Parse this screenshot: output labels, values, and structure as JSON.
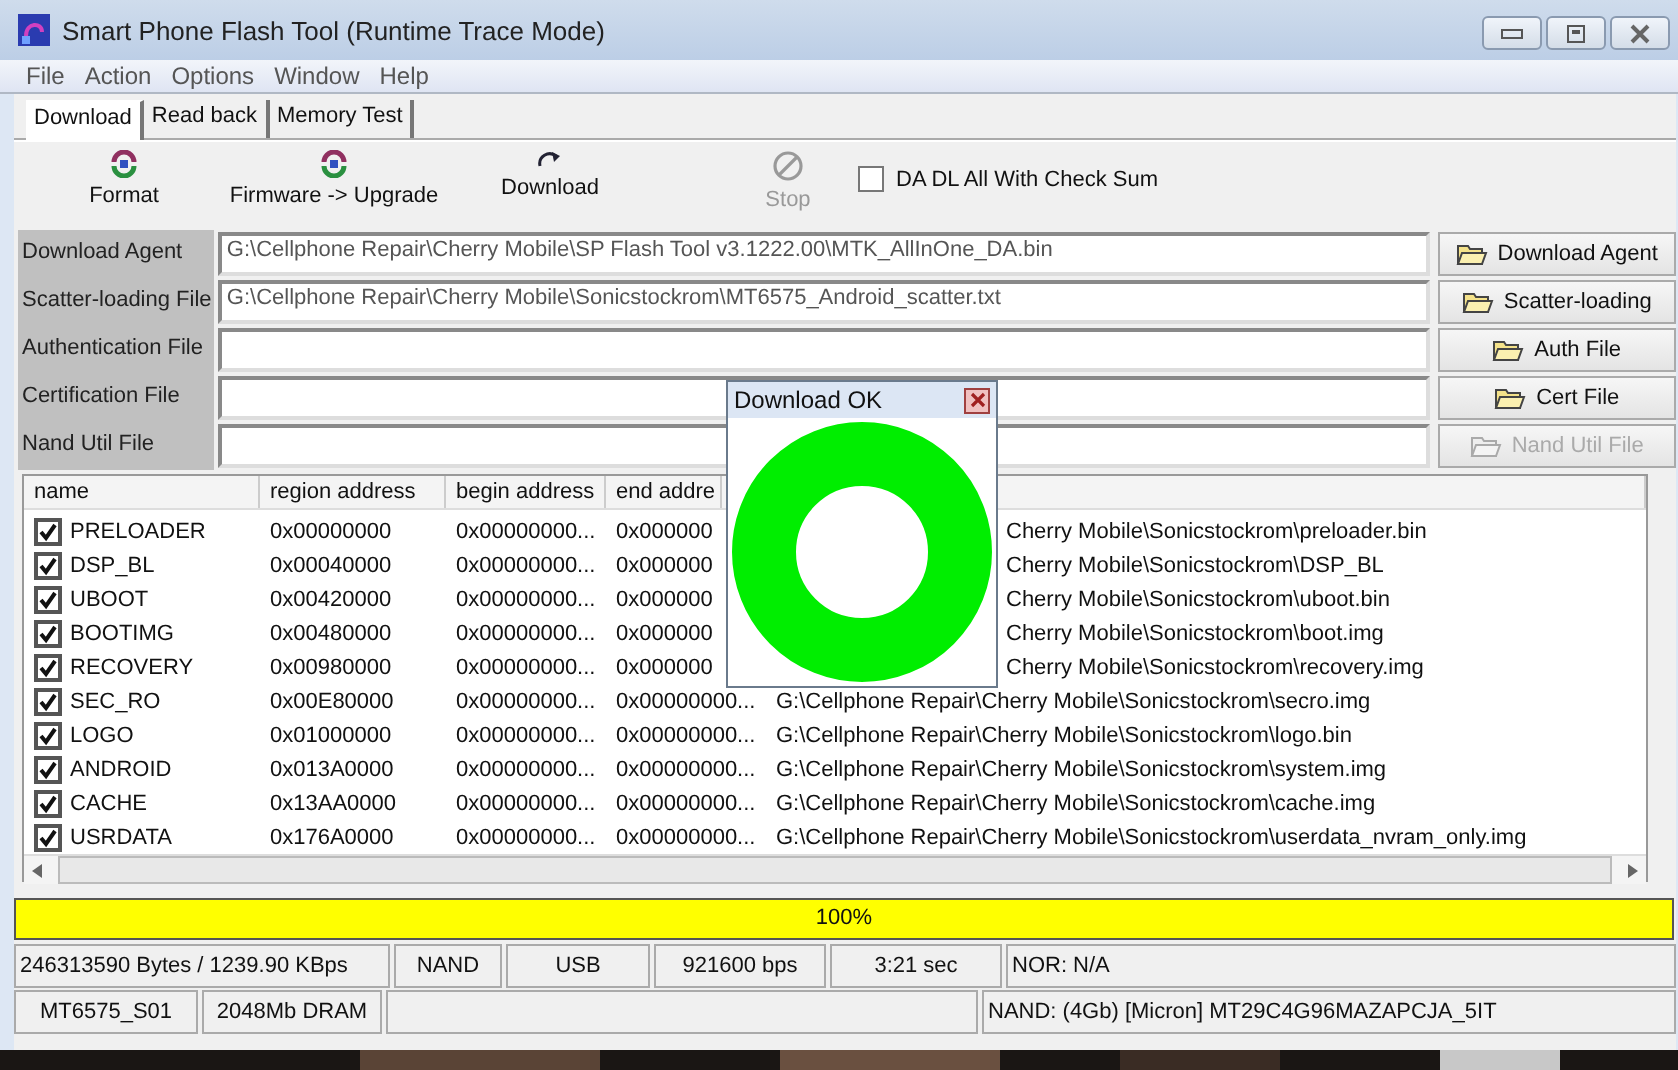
{
  "window": {
    "title": "Smart Phone Flash Tool (Runtime Trace Mode)"
  },
  "menu": [
    "File",
    "Action",
    "Options",
    "Window",
    "Help"
  ],
  "tabs": [
    {
      "label": "Download",
      "selected": true
    },
    {
      "label": "Read back",
      "selected": false
    },
    {
      "label": "Memory Test",
      "selected": false
    }
  ],
  "toolbar": [
    {
      "label": "Format",
      "kind": "format",
      "disabled": false
    },
    {
      "label": "Firmware -> Upgrade",
      "kind": "format",
      "disabled": false
    },
    {
      "label": "Download",
      "kind": "download",
      "disabled": false
    },
    {
      "label": "Stop",
      "kind": "stop",
      "disabled": true
    }
  ],
  "checksum": {
    "label": "DA DL All With Check Sum",
    "checked": false
  },
  "files": [
    {
      "label": "Download Agent",
      "value": "G:\\Cellphone Repair\\Cherry Mobile\\SP Flash Tool v3.1222.00\\MTK_AllInOne_DA.bin",
      "button": "Download Agent",
      "disabled": false
    },
    {
      "label": "Scatter-loading File",
      "value": "G:\\Cellphone Repair\\Cherry Mobile\\Sonicstockrom\\MT6575_Android_scatter.txt",
      "button": "Scatter-loading",
      "disabled": false
    },
    {
      "label": "Authentication File",
      "button": "Auth File",
      "disabled": false
    },
    {
      "label": "Certification File",
      "button": "Cert File",
      "disabled": false
    },
    {
      "label": "Nand Util File",
      "button": "Nand Util File",
      "disabled": true
    }
  ],
  "table": {
    "columns": [
      "name",
      "region address",
      "begin address",
      "end addre"
    ],
    "rows": [
      {
        "name": "PRELOADER",
        "checked": true,
        "region": "0x00000000",
        "begin": "0x00000000...",
        "end": "0x000000",
        "location": "Cherry Mobile\\Sonicstockrom\\preloader.bin",
        "covered": true
      },
      {
        "name": "DSP_BL",
        "checked": true,
        "region": "0x00040000",
        "begin": "0x00000000...",
        "end": "0x000000",
        "location": "Cherry Mobile\\Sonicstockrom\\DSP_BL",
        "covered": true
      },
      {
        "name": "UBOOT",
        "checked": true,
        "region": "0x00420000",
        "begin": "0x00000000...",
        "end": "0x000000",
        "location": "Cherry Mobile\\Sonicstockrom\\uboot.bin",
        "covered": true
      },
      {
        "name": "BOOTIMG",
        "checked": true,
        "region": "0x00480000",
        "begin": "0x00000000...",
        "end": "0x000000",
        "location": "Cherry Mobile\\Sonicstockrom\\boot.img",
        "covered": true
      },
      {
        "name": "RECOVERY",
        "checked": true,
        "region": "0x00980000",
        "begin": "0x00000000...",
        "end": "0x000000",
        "location": "Cherry Mobile\\Sonicstockrom\\recovery.img",
        "covered": true
      },
      {
        "name": "SEC_RO",
        "checked": true,
        "region": "0x00E80000",
        "begin": "0x00000000...",
        "end": "0x00000000...",
        "location": "G:\\Cellphone Repair\\Cherry Mobile\\Sonicstockrom\\secro.img",
        "covered": false
      },
      {
        "name": "LOGO",
        "checked": true,
        "region": "0x01000000",
        "begin": "0x00000000...",
        "end": "0x00000000...",
        "location": "G:\\Cellphone Repair\\Cherry Mobile\\Sonicstockrom\\logo.bin",
        "covered": false
      },
      {
        "name": "ANDROID",
        "checked": true,
        "region": "0x013A0000",
        "begin": "0x00000000...",
        "end": "0x00000000...",
        "location": "G:\\Cellphone Repair\\Cherry Mobile\\Sonicstockrom\\system.img",
        "covered": false
      },
      {
        "name": "CACHE",
        "checked": true,
        "region": "0x13AA0000",
        "begin": "0x00000000...",
        "end": "0x00000000...",
        "location": "G:\\Cellphone Repair\\Cherry Mobile\\Sonicstockrom\\cache.img",
        "covered": false
      },
      {
        "name": "USRDATA",
        "checked": true,
        "region": "0x176A0000",
        "begin": "0x00000000...",
        "end": "0x00000000...",
        "location": "G:\\Cellphone Repair\\Cherry Mobile\\Sonicstockrom\\userdata_nvram_only.img",
        "covered": false
      }
    ]
  },
  "progress": {
    "level": 1,
    "label": "100%"
  },
  "status_bar": {
    "row1": [
      "246313590 Bytes / 1239.90 KBps",
      "NAND",
      "USB",
      "921600 bps",
      "3:21 sec",
      "NOR: N/A"
    ],
    "row2": [
      "MT6575_S01",
      "2048Mb DRAM",
      "NAND: (4Gb) [Micron] MT29C4G96MAZAPCJA_5IT"
    ]
  },
  "dialog": {
    "title": "Download OK"
  }
}
